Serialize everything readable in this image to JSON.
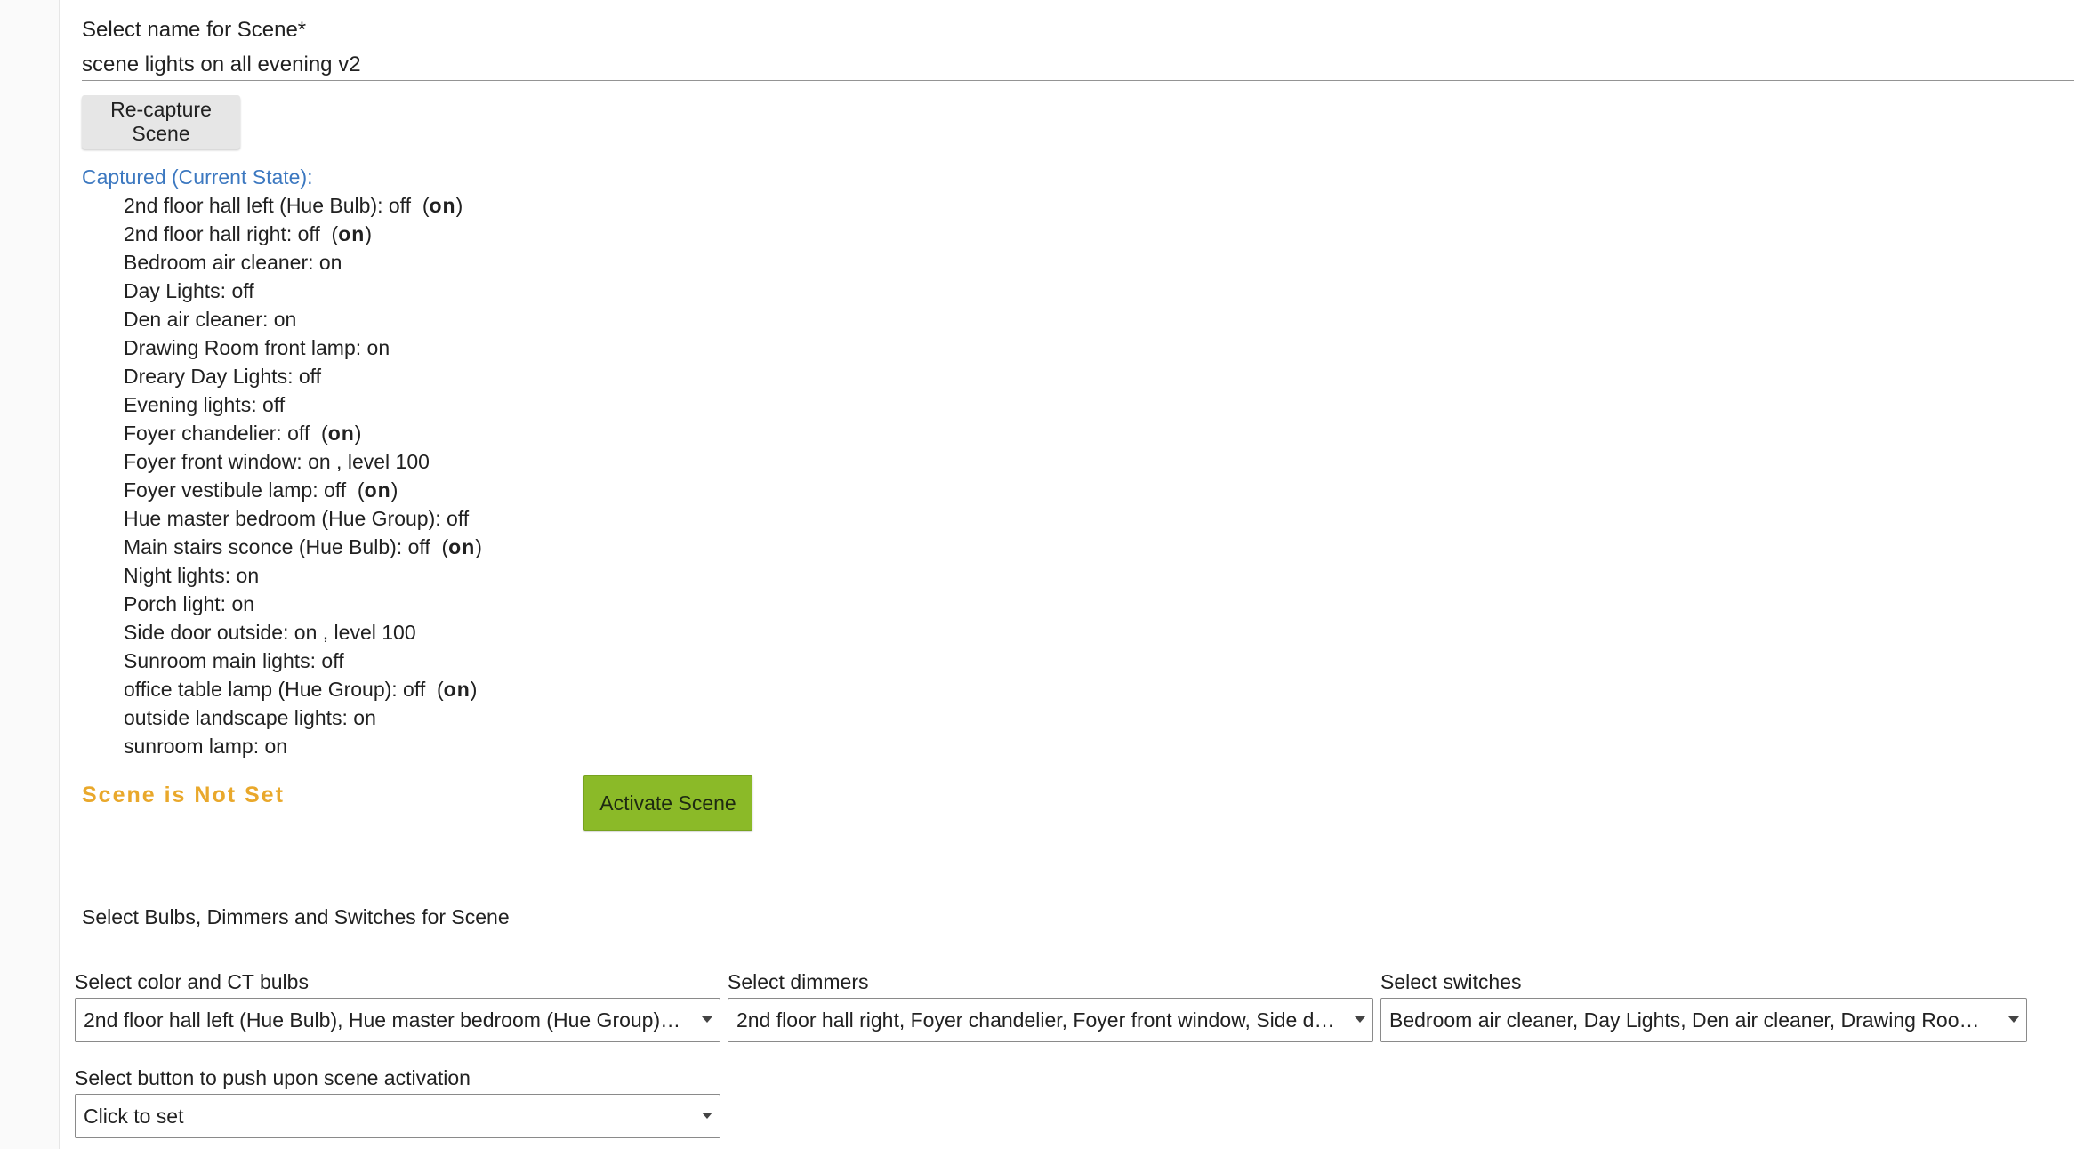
{
  "scene_name": {
    "label": "Select name for Scene*",
    "value": "scene lights on all evening v2"
  },
  "recapture_button": "Re-capture Scene",
  "captured": {
    "title": "Captured (Current State):",
    "items": [
      {
        "text": "2nd floor hall left (Hue Bulb): off  (",
        "bold": "on",
        "suffix": ")"
      },
      {
        "text": "2nd floor hall right: off  (",
        "bold": "on",
        "suffix": ")"
      },
      {
        "text": "Bedroom air cleaner: on",
        "bold": "",
        "suffix": ""
      },
      {
        "text": "Day Lights: off",
        "bold": "",
        "suffix": ""
      },
      {
        "text": "Den air cleaner: on",
        "bold": "",
        "suffix": ""
      },
      {
        "text": "Drawing Room front lamp: on",
        "bold": "",
        "suffix": ""
      },
      {
        "text": "Dreary Day Lights: off",
        "bold": "",
        "suffix": ""
      },
      {
        "text": "Evening lights: off",
        "bold": "",
        "suffix": ""
      },
      {
        "text": "Foyer chandelier: off  (",
        "bold": "on",
        "suffix": ")"
      },
      {
        "text": "Foyer front window: on , level 100",
        "bold": "",
        "suffix": ""
      },
      {
        "text": "Foyer vestibule lamp: off  (",
        "bold": "on",
        "suffix": ")"
      },
      {
        "text": "Hue master bedroom (Hue Group): off",
        "bold": "",
        "suffix": ""
      },
      {
        "text": "Main stairs sconce (Hue Bulb): off  (",
        "bold": "on",
        "suffix": ")"
      },
      {
        "text": "Night lights: on",
        "bold": "",
        "suffix": ""
      },
      {
        "text": "Porch light: on",
        "bold": "",
        "suffix": ""
      },
      {
        "text": "Side door outside: on , level 100",
        "bold": "",
        "suffix": ""
      },
      {
        "text": "Sunroom main lights: off",
        "bold": "",
        "suffix": ""
      },
      {
        "text": "office table lamp (Hue Group): off  (",
        "bold": "on",
        "suffix": ")"
      },
      {
        "text": "outside landscape lights: on",
        "bold": "",
        "suffix": ""
      },
      {
        "text": "sunroom lamp: on",
        "bold": "",
        "suffix": ""
      }
    ]
  },
  "scene_status": "Scene is Not Set",
  "activate_button": "Activate Scene",
  "devices_section_title": "Select Bulbs, Dimmers and Switches for Scene",
  "selects": {
    "bulbs": {
      "label": "Select color and CT bulbs",
      "value": "2nd floor hall left (Hue Bulb), Hue master bedroom (Hue Group), Main stairs sconce (Hue Bulb), office table lamp (Hue Group)"
    },
    "dimmers": {
      "label": "Select dimmers",
      "value": "2nd floor hall right, Foyer chandelier, Foyer front window, Side door outside"
    },
    "switches": {
      "label": "Select switches",
      "value": "Bedroom air cleaner, Day Lights, Den air cleaner, Drawing Room front lamp"
    },
    "button": {
      "label": "Select button to push upon scene activation",
      "value": "Click to set"
    }
  },
  "colors": {
    "captured_title": "#3c78c0",
    "scene_status": "#e9a82b",
    "activate_button": "#8bba28",
    "recapture_button": "#e6e6e6"
  },
  "icons": {
    "select_caret": "caret-down-icon"
  }
}
